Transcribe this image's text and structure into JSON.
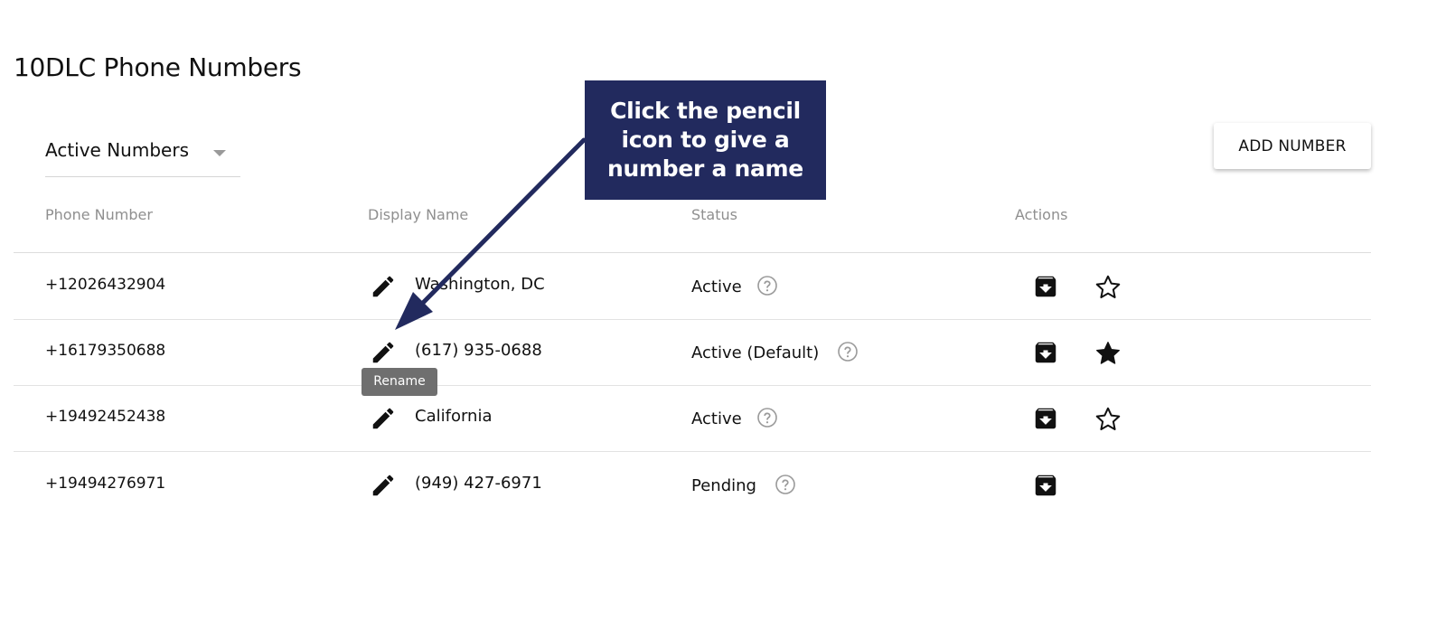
{
  "page": {
    "title": "10DLC Phone Numbers"
  },
  "filter": {
    "selected": "Active Numbers",
    "caret_icon": "caret-down-icon"
  },
  "toolbar": {
    "add_number_label": "ADD NUMBER"
  },
  "table": {
    "columns": [
      "Phone Number",
      "Display Name",
      "Status",
      "Actions"
    ],
    "rows": [
      {
        "phone": "+12026432904",
        "display_name": "Washington, DC",
        "status": "Active",
        "favorite": "outline"
      },
      {
        "phone": "+16179350688",
        "display_name": "(617) 935-0688",
        "status": "Active (Default)",
        "favorite": "filled"
      },
      {
        "phone": "+19492452438",
        "display_name": "California",
        "status": "Active",
        "favorite": "outline"
      },
      {
        "phone": "+19494276971",
        "display_name": "(949) 427-6971",
        "status": "Pending",
        "favorite": "none"
      }
    ]
  },
  "tooltip": {
    "text": "Rename"
  },
  "annotation": {
    "text": "Click the pencil icon to give a number a name",
    "background": "#222a5e",
    "text_color": "#ffffff"
  },
  "icons": {
    "edit": "pencil-icon",
    "help": "help-circle-icon",
    "archive": "archive-icon",
    "favorite_outline": "star-outline-icon",
    "favorite_filled": "star-filled-icon"
  }
}
